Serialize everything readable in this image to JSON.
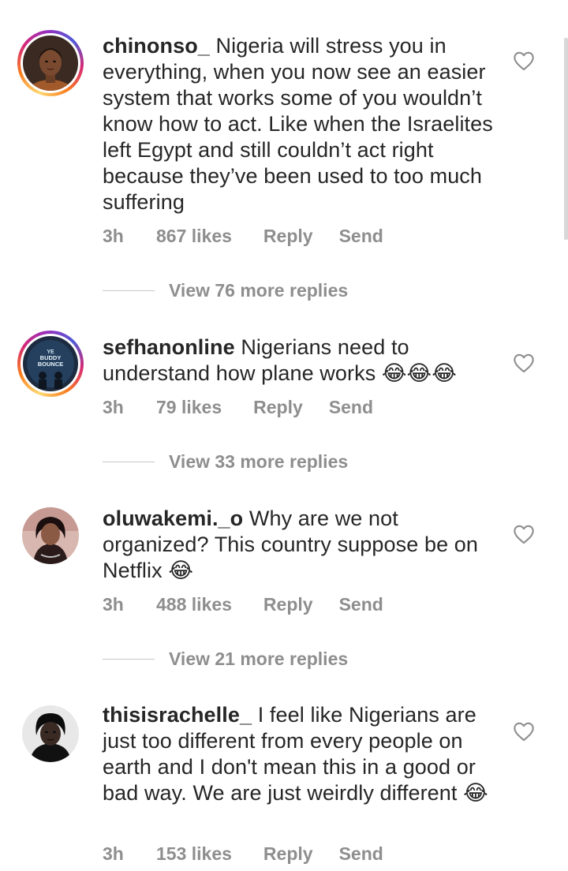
{
  "comments": [
    {
      "username": "chinonso_",
      "text": " Nigeria will stress you in everything, when you now see an easier system that works some of you wouldn’t know how to act. Like when the Israelites left Egypt and still couldn’t act right because they’ve been used to too much suffering",
      "time": "3h",
      "likes": "867 likes",
      "reply": "Reply",
      "send": "Send",
      "view_replies": "View 76 more replies",
      "has_story": true
    },
    {
      "username": "sefhanonline",
      "text": " Nigerians need to understand how plane works 😂😂😂",
      "time": "3h",
      "likes": "79 likes",
      "reply": "Reply",
      "send": "Send",
      "view_replies": "View 33 more replies",
      "has_story": true,
      "avatar_text": [
        "YE",
        "BUDDY",
        "BOUNCE"
      ]
    },
    {
      "username": "oluwakemi._o",
      "text": " Why are we not organized? This country suppose be on Netflix 😂",
      "time": "3h",
      "likes": "488 likes",
      "reply": "Reply",
      "send": "Send",
      "view_replies": "View 21 more replies",
      "has_story": false
    },
    {
      "username": "thisisrachelle_",
      "text": " I feel like Nigerians are just too different from every people on earth and I don't mean this in a good or bad way. We are just weirdly different 😂",
      "time": "3h",
      "likes": "153 likes",
      "reply": "Reply",
      "send": "Send",
      "has_story": false
    }
  ],
  "icons": {
    "like": "heart-outline-icon"
  },
  "colors": {
    "text": "#262626",
    "secondary": "#8e8e8e",
    "divider": "#c7c7c7"
  }
}
